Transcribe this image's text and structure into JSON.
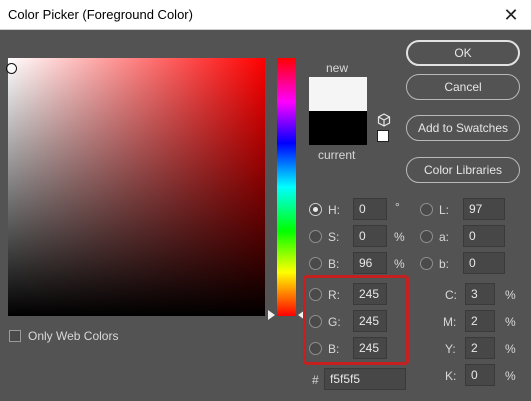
{
  "window": {
    "title": "Color Picker (Foreground Color)"
  },
  "swatch": {
    "new_label": "new",
    "current_label": "current"
  },
  "buttons": {
    "ok": "OK",
    "cancel": "Cancel",
    "add_to_swatches": "Add to Swatches",
    "color_libraries": "Color Libraries"
  },
  "hsb": {
    "h": {
      "label": "H:",
      "value": "0",
      "unit": "°"
    },
    "s": {
      "label": "S:",
      "value": "0",
      "unit": "%"
    },
    "b": {
      "label": "B:",
      "value": "96",
      "unit": "%"
    }
  },
  "lab": {
    "l": {
      "label": "L:",
      "value": "97"
    },
    "a": {
      "label": "a:",
      "value": "0"
    },
    "b": {
      "label": "b:",
      "value": "0"
    }
  },
  "rgb": {
    "r": {
      "label": "R:",
      "value": "245"
    },
    "g": {
      "label": "G:",
      "value": "245"
    },
    "b": {
      "label": "B:",
      "value": "245"
    }
  },
  "cmyk": {
    "c": {
      "label": "C:",
      "value": "3",
      "unit": "%"
    },
    "m": {
      "label": "M:",
      "value": "2",
      "unit": "%"
    },
    "y": {
      "label": "Y:",
      "value": "2",
      "unit": "%"
    },
    "k": {
      "label": "K:",
      "value": "0",
      "unit": "%"
    }
  },
  "hex": {
    "label": "#",
    "value": "f5f5f5"
  },
  "only_web_colors": {
    "label": "Only Web Colors",
    "checked": false
  },
  "colors": {
    "new": "#f5f5f5",
    "current": "#000000",
    "highlight": "#c51f1f"
  }
}
